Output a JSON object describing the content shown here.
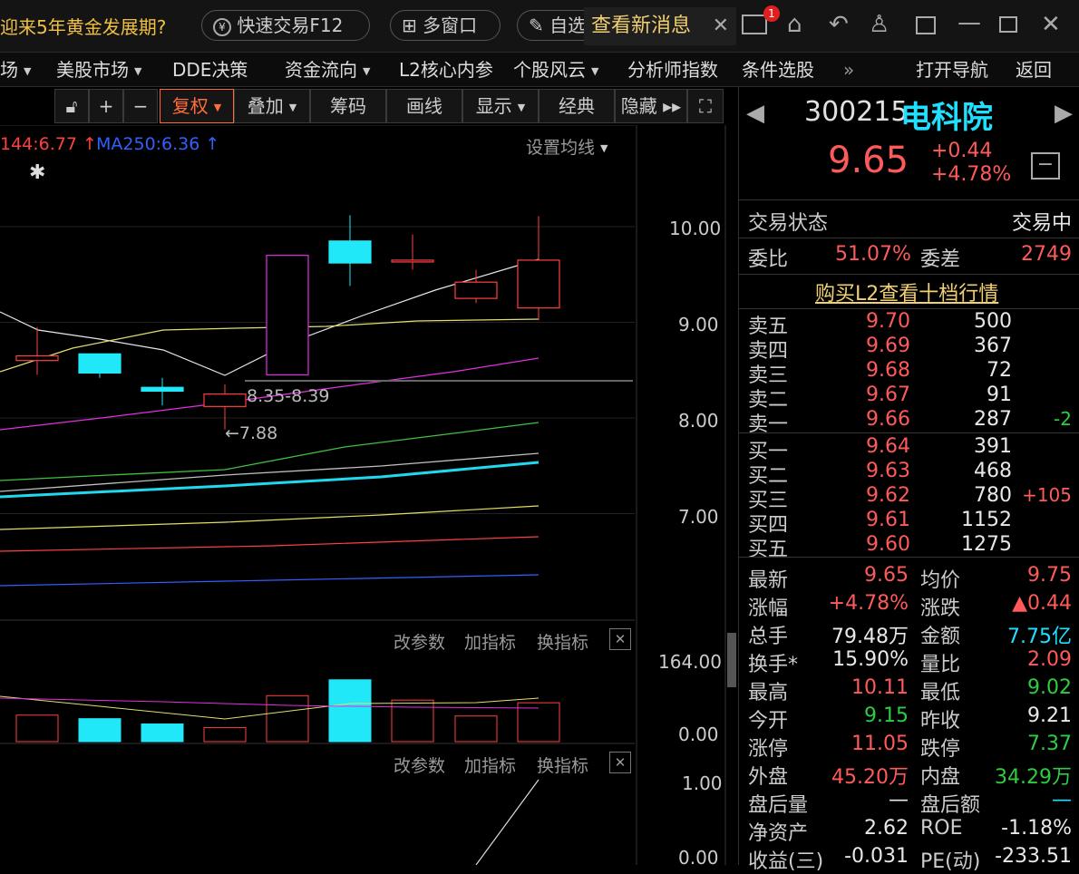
{
  "topbar": {
    "news": "迎来5年黄金发展期?",
    "quick_trade": "快速交易F12",
    "multi_window": "多窗口",
    "watch": "自选",
    "new_msg": "查看新消息",
    "msg_badge": "1"
  },
  "menu": {
    "m0": "场",
    "m1": "美股市场",
    "m2": "DDE决策",
    "m3": "资金流向",
    "m4": "L2核心内参",
    "m5": "个股风云",
    "m6": "分析师指数",
    "m7": "条件选股",
    "more": "»",
    "nav": "打开导航",
    "back": "返回"
  },
  "toolbar": {
    "fuquan": "复权",
    "diejia": "叠加",
    "chouma": "筹码",
    "huaxian": "画线",
    "xianshi": "显示",
    "jingdian": "经典",
    "yincang": "隐藏"
  },
  "chart": {
    "ma144": "144:6.77",
    "ma250": "MA250:6.36",
    "set_ma": "设置均线",
    "star": "✱",
    "range_label": "8.35-8.39",
    "low_label": "←7.88",
    "y_ticks": [
      "10.00",
      "9.00",
      "8.00",
      "7.00"
    ],
    "vol_ticks": [
      "164.00",
      "0.00"
    ],
    "ind_ticks": [
      "1.00",
      "0.00"
    ],
    "gaicanshu": "改参数",
    "jiazhibiao": "加指标",
    "huanzhibiao": "换指标"
  },
  "chart_data": {
    "type": "candlestick",
    "candles": [
      {
        "o": 8.6,
        "c": 8.65,
        "h": 8.95,
        "l": 8.45
      },
      {
        "o": 8.67,
        "c": 8.47,
        "h": 8.67,
        "l": 8.42
      },
      {
        "o": 8.32,
        "c": 8.28,
        "h": 8.42,
        "l": 8.13
      },
      {
        "o": 8.12,
        "c": 8.25,
        "h": 8.35,
        "l": 7.88
      },
      {
        "o": 8.45,
        "c": 9.7,
        "h": 9.7,
        "l": 8.45
      },
      {
        "o": 9.85,
        "c": 9.62,
        "h": 10.12,
        "l": 9.38
      },
      {
        "o": 9.65,
        "c": 9.65,
        "h": 9.92,
        "l": 9.55
      },
      {
        "o": 9.25,
        "c": 9.42,
        "h": 9.55,
        "l": 9.2
      },
      {
        "o": 9.15,
        "c": 9.65,
        "h": 10.11,
        "l": 9.02
      }
    ],
    "volume": [
      30,
      26,
      20,
      16,
      52,
      70,
      47,
      29,
      44
    ]
  },
  "stock": {
    "code": "300215",
    "name": "电科院",
    "price": "9.65",
    "change": "+0.44",
    "pct": "+4.78%"
  },
  "status": {
    "label": "交易状态",
    "value": "交易中"
  },
  "weibi": {
    "l1": "委比",
    "v1": "51.07%",
    "l2": "委差",
    "v2": "2749"
  },
  "l2link": "购买L2查看十档行情",
  "asks": [
    {
      "n": "卖五",
      "p": "9.70",
      "v": "500",
      "d": ""
    },
    {
      "n": "卖四",
      "p": "9.69",
      "v": "367",
      "d": ""
    },
    {
      "n": "卖三",
      "p": "9.68",
      "v": "72",
      "d": ""
    },
    {
      "n": "卖二",
      "p": "9.67",
      "v": "91",
      "d": ""
    },
    {
      "n": "卖一",
      "p": "9.66",
      "v": "287",
      "d": "-2"
    }
  ],
  "bids": [
    {
      "n": "买一",
      "p": "9.64",
      "v": "391",
      "d": ""
    },
    {
      "n": "买二",
      "p": "9.63",
      "v": "468",
      "d": ""
    },
    {
      "n": "买三",
      "p": "9.62",
      "v": "780",
      "d": "+105"
    },
    {
      "n": "买四",
      "p": "9.61",
      "v": "1152",
      "d": ""
    },
    {
      "n": "买五",
      "p": "9.60",
      "v": "1275",
      "d": ""
    }
  ],
  "stats": [
    {
      "l1": "最新",
      "v1": "9.65",
      "c1": "red",
      "l2": "均价",
      "v2": "9.75",
      "c2": "red"
    },
    {
      "l1": "涨幅",
      "v1": "+4.78%",
      "c1": "red",
      "l2": "涨跌",
      "v2": "▲0.44",
      "c2": "red"
    },
    {
      "l1": "总手",
      "v1": "79.48万",
      "c1": "white",
      "l2": "金额",
      "v2": "7.75亿",
      "c2": "cyan"
    },
    {
      "l1": "换手*",
      "v1": "15.90%",
      "c1": "white",
      "l2": "量比",
      "v2": "2.09",
      "c2": "red"
    },
    {
      "l1": "最高",
      "v1": "10.11",
      "c1": "red",
      "l2": "最低",
      "v2": "9.02",
      "c2": "green"
    },
    {
      "l1": "今开",
      "v1": "9.15",
      "c1": "green",
      "l2": "昨收",
      "v2": "9.21",
      "c2": "white"
    },
    {
      "l1": "涨停",
      "v1": "11.05",
      "c1": "red",
      "l2": "跌停",
      "v2": "7.37",
      "c2": "green"
    },
    {
      "l1": "外盘",
      "v1": "45.20万",
      "c1": "red",
      "l2": "内盘",
      "v2": "34.29万",
      "c2": "green"
    },
    {
      "l1": "盘后量",
      "v1": "—",
      "c1": "white",
      "l2": "盘后额",
      "v2": "—",
      "c2": "cyan"
    },
    {
      "l1": "净资产",
      "v1": "2.62",
      "c1": "white",
      "l2": "ROE",
      "v2": "-1.18%",
      "c2": "white"
    },
    {
      "l1": "收益(三)",
      "v1": "-0.031",
      "c1": "white",
      "l2": "PE(动)",
      "v2": "-233.51",
      "c2": "white"
    }
  ]
}
